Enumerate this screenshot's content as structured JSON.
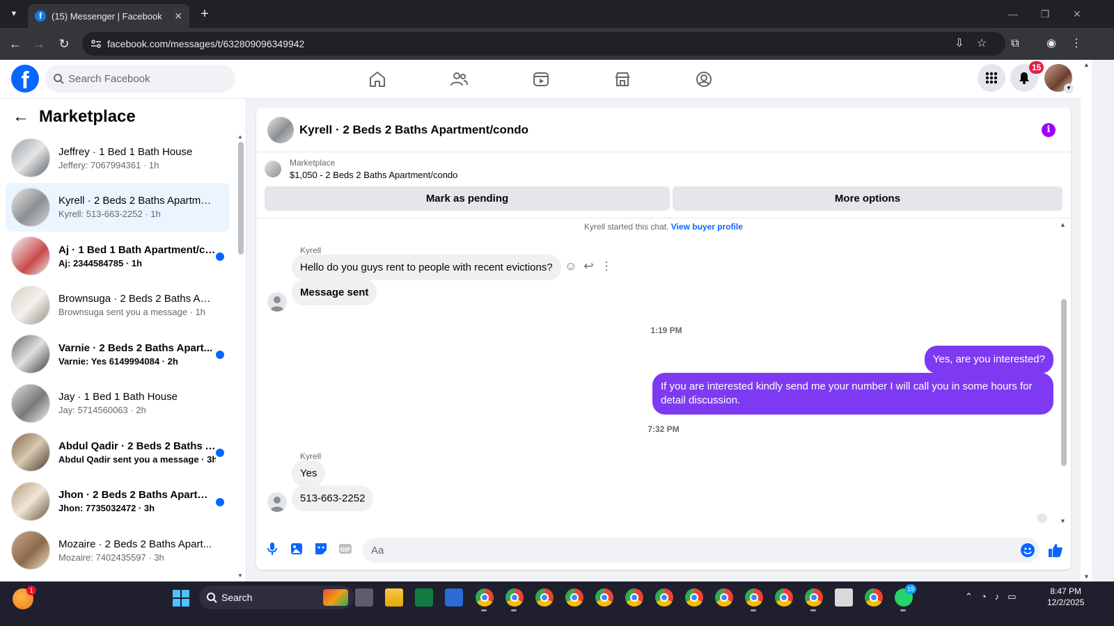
{
  "browser": {
    "tab_title": "(15) Messenger | Facebook",
    "url": "facebook.com/messages/t/632809096349942"
  },
  "fb": {
    "search_placeholder": "Search Facebook",
    "notification_count": "15"
  },
  "sidebar": {
    "title": "Marketplace",
    "conversations": [
      {
        "name": "Jeffrey · 1 Bed 1 Bath House",
        "preview": "Jeffery: 7067994361 · 1h",
        "unread": false,
        "selected": false
      },
      {
        "name": "Kyrell · 2 Beds 2 Baths Apartmen...",
        "preview": "Kyrell: 513-663-2252 · 1h",
        "unread": false,
        "selected": true
      },
      {
        "name": "Aj · 1 Bed 1 Bath Apartment/co...",
        "preview": "Aj: 2344584785 · 1h",
        "unread": true,
        "selected": false
      },
      {
        "name": "Brownsuga · 2 Beds 2 Baths Apa...",
        "preview": "Brownsuga sent you a message · 1h",
        "unread": false,
        "selected": false
      },
      {
        "name": "Varnie · 2 Beds 2 Baths Apart...",
        "preview": "Varnie: Yes 6149994084 · 2h",
        "unread": true,
        "selected": false
      },
      {
        "name": "Jay · 1 Bed 1 Bath House",
        "preview": "Jay: 5714560063 · 2h",
        "unread": false,
        "selected": false
      },
      {
        "name": "Abdul Qadir · 2 Beds 2 Baths A...",
        "preview": "Abdul Qadir sent you a message · 3h",
        "unread": true,
        "selected": false
      },
      {
        "name": "Jhon · 2 Beds 2 Baths Apartme...",
        "preview": "Jhon: 7735032472 · 3h",
        "unread": true,
        "selected": false
      },
      {
        "name": "Mozaire · 2 Beds 2 Baths Apart...",
        "preview": "Mozaire: 7402435597 · 3h",
        "unread": false,
        "selected": false
      }
    ]
  },
  "chat": {
    "title": "Kyrell · 2 Beds 2 Baths Apartment/condo",
    "listing_label": "Marketplace",
    "listing_detail": "$1,050 - 2 Beds 2 Baths Apartment/condo",
    "mark_pending": "Mark as pending",
    "more_options": "More options",
    "system_text": "Kyrell started this chat.",
    "system_link": "View buyer profile",
    "sender1": "Kyrell",
    "msg_in_1": "Hello do you guys rent to people with recent evictions?",
    "msg_in_2": "Message sent",
    "time1": "1:19 PM",
    "msg_out_1": "Yes, are you interested?",
    "msg_out_2": "If you are interested kindly send me your number I will call you in some hours for detail discussion.",
    "time2": "7:32 PM",
    "sender2": "Kyrell",
    "msg_in_3": "Yes",
    "msg_in_4": "513-663-2252",
    "input_placeholder": "Aa",
    "gif_label": "GIF"
  },
  "taskbar": {
    "search_label": "Search",
    "clock_time": "8:47 PM",
    "clock_date": "12/2/2025",
    "weather_badge": "1",
    "whatsapp_badge": "19"
  },
  "colors": {
    "fb_blue": "#0866ff",
    "outgoing_bubble": "#7e3af2",
    "selected_conv": "#ebf5ff",
    "unread_dot": "#0866ff",
    "notif_badge": "#e41e3f"
  }
}
